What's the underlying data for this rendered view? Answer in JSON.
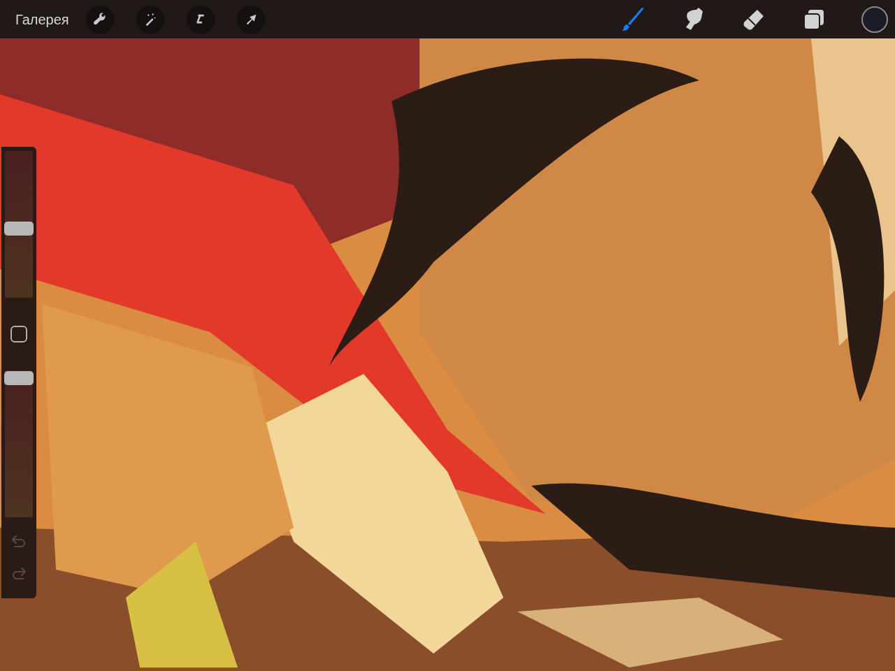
{
  "toolbar": {
    "gallery": "Галерея",
    "actions": [
      {
        "kind": "wrench"
      },
      {
        "kind": "wand"
      },
      {
        "kind": "selection"
      },
      {
        "kind": "transform"
      }
    ],
    "tools": [
      {
        "kind": "brush",
        "selected": true
      },
      {
        "kind": "smudge",
        "selected": false
      },
      {
        "kind": "eraser",
        "selected": false
      },
      {
        "kind": "layers",
        "selected": false
      }
    ]
  },
  "sidebar": {
    "size_slider": {
      "level": 0.47
    },
    "opacity_slider": {
      "level": 0.95
    },
    "undo": {
      "disabled": true
    },
    "redo": {
      "disabled": true
    }
  }
}
